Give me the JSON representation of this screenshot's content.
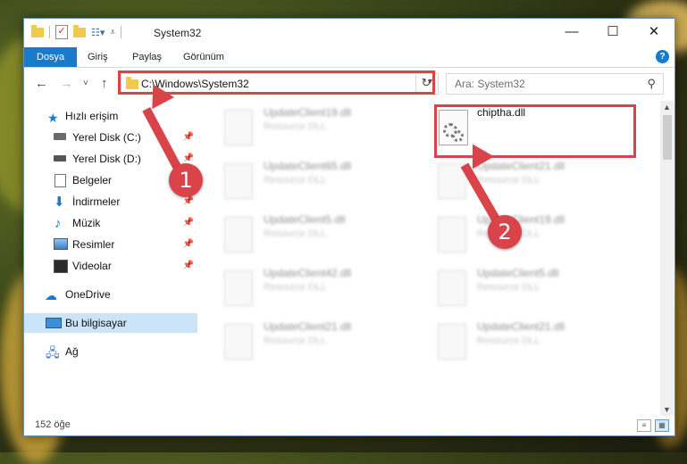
{
  "window": {
    "title": "System32",
    "controls": {
      "minimize": "—",
      "maximize": "☐",
      "close": "✕"
    }
  },
  "ribbon": {
    "tabs": [
      "Dosya",
      "Giriş",
      "Paylaş",
      "Görünüm"
    ],
    "active_tab": "Dosya",
    "help": "?"
  },
  "address": {
    "path": "C:\\Windows\\System32",
    "search_placeholder": "Ara: System32"
  },
  "sidebar": {
    "quick_access": "Hızlı erişim",
    "items": [
      {
        "label": "Yerel Disk (C:)",
        "icon": "drive-icon",
        "pinned": true
      },
      {
        "label": "Yerel Disk (D:)",
        "icon": "drive-icon",
        "pinned": true
      },
      {
        "label": "Belgeler",
        "icon": "documents-icon",
        "pinned": true
      },
      {
        "label": "İndirmeler",
        "icon": "download-icon",
        "pinned": true
      },
      {
        "label": "Müzik",
        "icon": "music-icon",
        "pinned": true
      },
      {
        "label": "Resimler",
        "icon": "pictures-icon",
        "pinned": true
      },
      {
        "label": "Videolar",
        "icon": "videos-icon",
        "pinned": true
      }
    ],
    "onedrive": "OneDrive",
    "this_pc": "Bu bilgisayar",
    "network": "Ağ"
  },
  "files": {
    "left_column": [
      {
        "name": "UpdateClient19.dll",
        "type": "Resource DLL"
      },
      {
        "name": "UpdateClient65.dll",
        "type": "Resource DLL"
      },
      {
        "name": "UpdateClient5.dll",
        "type": "Resource DLL"
      },
      {
        "name": "UpdateClient42.dll",
        "type": "Resource DLL"
      },
      {
        "name": "UpdateClient21.dll",
        "type": "Resource DLL"
      }
    ],
    "right_column": [
      {
        "name": "chiptha.dll",
        "type": ""
      },
      {
        "name": "UpdateClient21.dll",
        "type": "Resource DLL"
      },
      {
        "name": "UpdateClient19.dll",
        "type": "Resource DLL"
      },
      {
        "name": "UpdateClient5.dll",
        "type": "Resource DLL"
      },
      {
        "name": "UpdateClient21.dll",
        "type": "Resource DLL"
      }
    ]
  },
  "status": {
    "item_count": "152 öğe"
  },
  "annotations": {
    "marker1": "1",
    "marker2": "2",
    "color": "#d9444a"
  }
}
